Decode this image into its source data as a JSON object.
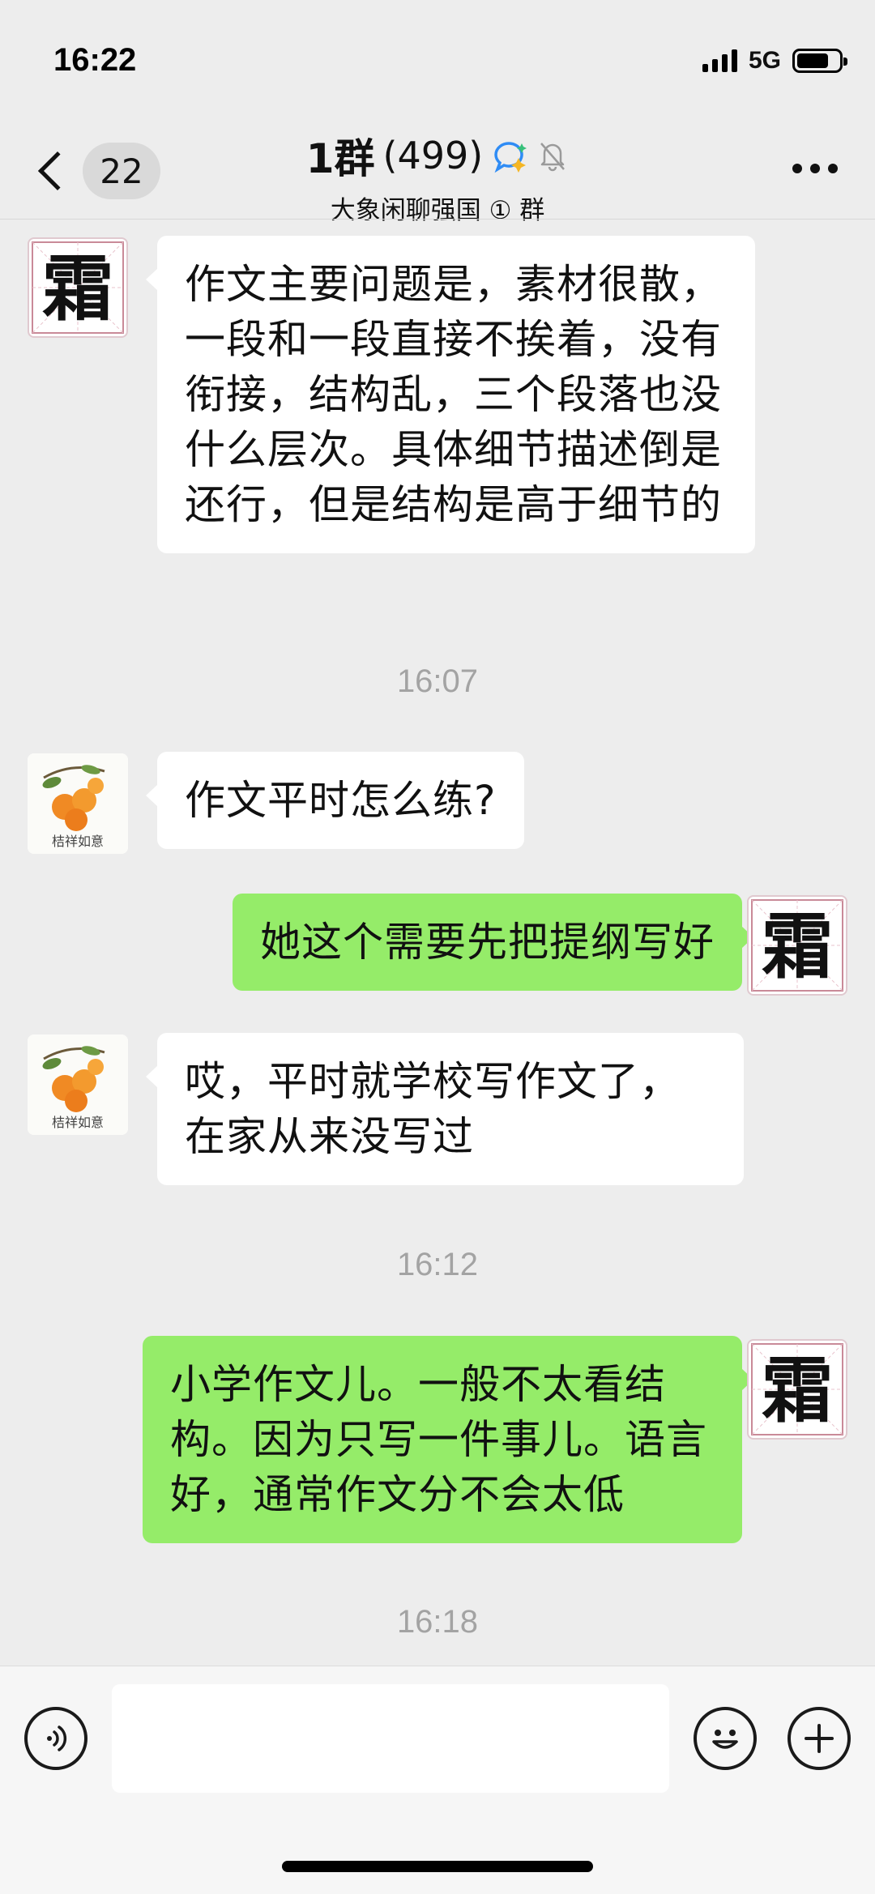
{
  "status_bar": {
    "time": "16:22",
    "network": "5G",
    "battery_level": 0.75
  },
  "header": {
    "back_badge": "22",
    "title": "1群",
    "member_count": "(499)",
    "subtitle": "大象闲聊强国 ① 群",
    "icons": [
      "chevron-left-icon",
      "ai-chat-icon",
      "mute-bell-icon",
      "more-icon"
    ]
  },
  "messages": [
    {
      "side": "left",
      "avatar": "frost-avatar",
      "text": "作文主要问题是，素材很散，一段和一段直接不挨着，没有衔接，结构乱，三个段落也没什么层次。具体细节描述倒是还行，但是结构是高于细节的"
    },
    {
      "timestamp": "16:07"
    },
    {
      "side": "left",
      "avatar": "orange-avatar",
      "avatar_caption": "桔祥如意",
      "text": "作文平时怎么练?"
    },
    {
      "side": "right",
      "avatar": "frost-avatar",
      "text": "她这个需要先把提纲写好"
    },
    {
      "side": "left",
      "avatar": "orange-avatar",
      "avatar_caption": "桔祥如意",
      "text": "哎，平时就学校写作文了，在家从来没写过"
    },
    {
      "timestamp": "16:12"
    },
    {
      "side": "right",
      "avatar": "frost-avatar",
      "text": "小学作文儿。一般不太看结构。因为只写一件事儿。语言好，通常作文分不会太低"
    },
    {
      "timestamp": "16:18"
    }
  ],
  "avatars": {
    "frost_char": "霜",
    "orange_caption": "桔祥如意"
  },
  "input_bar": {
    "placeholder": "",
    "icons": [
      "voice-icon",
      "emoji-icon",
      "plus-icon"
    ]
  },
  "colors": {
    "background": "#ededed",
    "incoming_bubble": "#ffffff",
    "outgoing_bubble": "#95ec69",
    "timestamp": "#a3a3a3"
  }
}
